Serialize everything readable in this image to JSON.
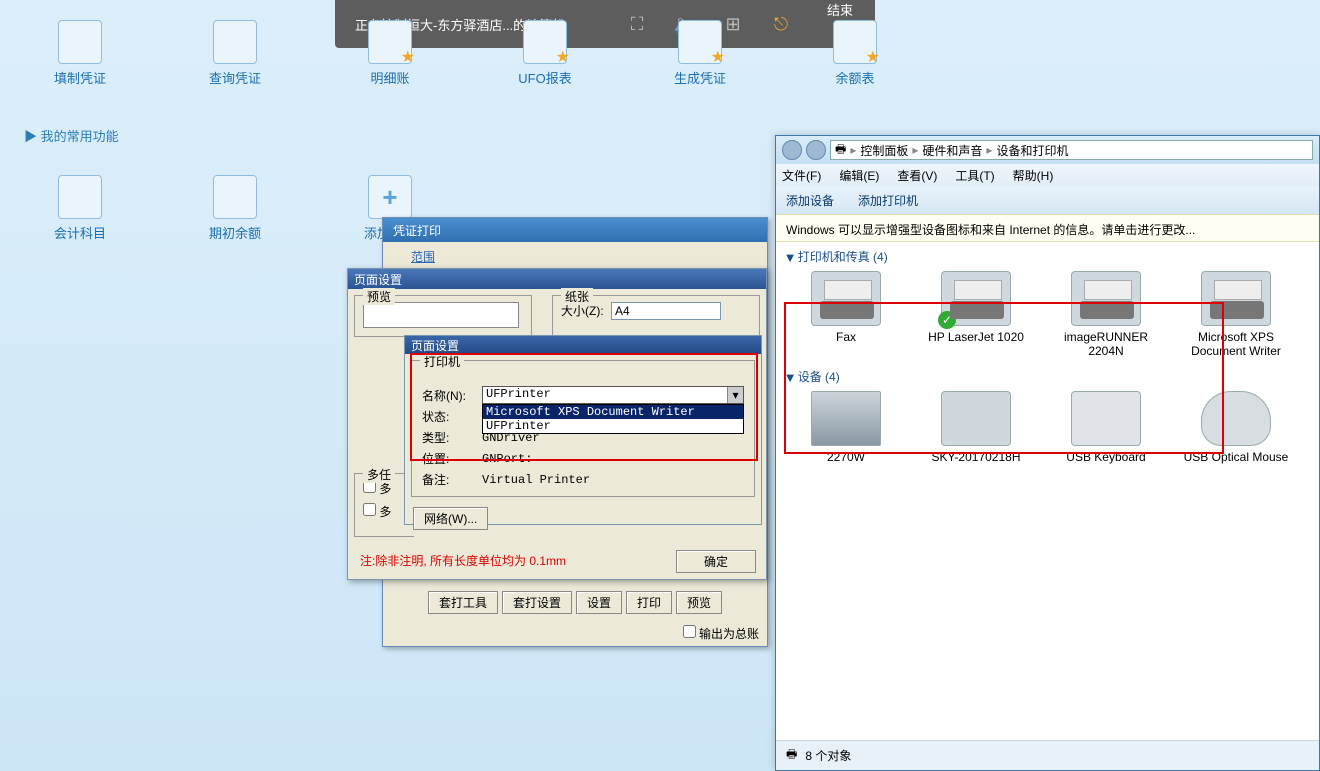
{
  "rc_bar": {
    "title": "正在控制恒大-东方驿酒店...的计算机",
    "end": "结束"
  },
  "shortcuts_row1": [
    "填制凭证",
    "查询凭证",
    "明细账",
    "UFO报表",
    "生成凭证",
    "余额表"
  ],
  "shortcuts_row2": [
    "会计科目",
    "期初余额",
    "添加更多"
  ],
  "my_func": "▶ 我的常用功能",
  "win1": {
    "title": "凭证打印",
    "link": "范围",
    "bottom_buttons": [
      "套打工具",
      "套打设置",
      "设置",
      "打印",
      "预览"
    ],
    "checkbox": "输出为总账"
  },
  "win2": {
    "title": "页面设置",
    "preview_label": "预览",
    "paper_label": "纸张",
    "size_label": "大小(Z):",
    "size_value": "A4",
    "multi_label": "多任",
    "multi_chk": "多",
    "note": "注:除非注明, 所有长度单位均为 0.1mm",
    "ok": "确定"
  },
  "win3": {
    "title": "页面设置",
    "group": "打印机",
    "rows": {
      "name": "名称(N):",
      "name_val": "UFPrinter",
      "status": "状态:",
      "type": "类型:",
      "type_val": "GNDriver",
      "where": "位置:",
      "where_val": "GNPort:",
      "comment": "备注:",
      "comment_val": "Virtual Printer"
    },
    "dropdown": [
      "Microsoft XPS Document Writer",
      "UFPrinter"
    ],
    "net_btn": "网络(W)..."
  },
  "explorer": {
    "breadcrumb": [
      "控制面板",
      "硬件和声音",
      "设备和打印机"
    ],
    "menus": [
      "文件(F)",
      "编辑(E)",
      "查看(V)",
      "工具(T)",
      "帮助(H)"
    ],
    "toolbar": [
      "添加设备",
      "添加打印机"
    ],
    "infobar": "Windows 可以显示增强型设备图标和来自 Internet 的信息。请单击进行更改...",
    "section_printers": "打印机和传真 (4)",
    "printers": [
      {
        "name": "Fax",
        "default": false
      },
      {
        "name": "HP LaserJet 1020",
        "default": true
      },
      {
        "name": "imageRUNNER 2204N",
        "default": false
      },
      {
        "name": "Microsoft XPS Document Writer",
        "default": false
      }
    ],
    "section_devices": "设备 (4)",
    "devices": [
      "2270W",
      "SKY-20170218H",
      "USB Keyboard",
      "USB Optical Mouse"
    ],
    "status": "8 个对象"
  }
}
